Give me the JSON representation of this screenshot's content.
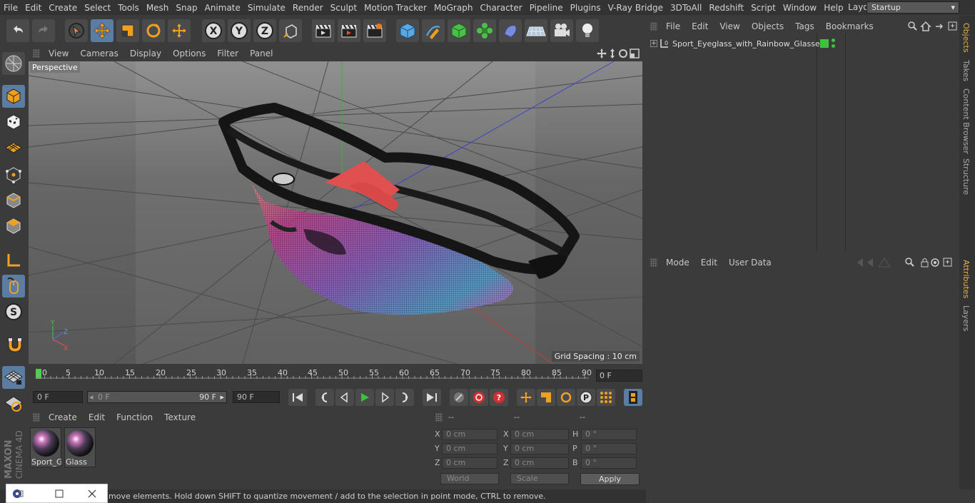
{
  "menubar": {
    "items": [
      "File",
      "Edit",
      "Create",
      "Select",
      "Tools",
      "Mesh",
      "Snap",
      "Animate",
      "Simulate",
      "Render",
      "Sculpt",
      "Motion Tracker",
      "MoGraph",
      "Character",
      "Pipeline",
      "Plugins",
      "V-Ray Bridge",
      "3DToAll",
      "Redshift",
      "Script",
      "Window",
      "Help"
    ],
    "layout_label": "Layout:",
    "layout_value": "Startup"
  },
  "viewport": {
    "menu": [
      "View",
      "Cameras",
      "Display",
      "Options",
      "Filter",
      "Panel"
    ],
    "label": "Perspective",
    "grid_spacing": "Grid Spacing : 10 cm"
  },
  "timeline": {
    "ticks": [
      "0",
      "5",
      "10",
      "15",
      "20",
      "25",
      "30",
      "35",
      "40",
      "45",
      "50",
      "55",
      "60",
      "65",
      "70",
      "75",
      "80",
      "85",
      "90"
    ],
    "current_frame": "0 F",
    "start_field": "0 F",
    "range_start": "0 F",
    "range_end": "90 F",
    "end_field": "90 F"
  },
  "materials": {
    "menu": [
      "Create",
      "Edit",
      "Function",
      "Texture"
    ],
    "items": [
      "Sport_G",
      "Glass"
    ]
  },
  "coords": {
    "headers": [
      "--",
      "--",
      "--"
    ],
    "rows": [
      {
        "a": "X",
        "av": "0 cm",
        "b": "X",
        "bv": "0 cm",
        "c": "H",
        "cv": "0 °"
      },
      {
        "a": "Y",
        "av": "0 cm",
        "b": "Y",
        "bv": "0 cm",
        "c": "P",
        "cv": "0 °"
      },
      {
        "a": "Z",
        "av": "0 cm",
        "b": "Z",
        "bv": "0 cm",
        "c": "B",
        "cv": "0 °"
      }
    ],
    "world": "World",
    "scale": "Scale",
    "apply": "Apply"
  },
  "objects": {
    "menu": [
      "File",
      "Edit",
      "View",
      "Objects",
      "Tags",
      "Bookmarks"
    ],
    "tree": [
      {
        "name": "Sport_Eyeglass_with_Rainbow_Glasses"
      }
    ]
  },
  "attributes": {
    "menu": [
      "Mode",
      "Edit",
      "User Data"
    ]
  },
  "sidetabs": {
    "top": [
      "Objects",
      "Takes",
      "Content Browser",
      "Structure"
    ],
    "bottom": [
      "Attributes",
      "Layers"
    ]
  },
  "status": {
    "text": "move elements. Hold down SHIFT to quantize movement / add to the selection in point mode, CTRL to remove."
  },
  "brand": {
    "maxon": "MAXON",
    "c4d": "CINEMA 4D"
  },
  "colors": {
    "accent": "#5c7da3",
    "active_tab": "#e0b04a",
    "green_tag": "#3ec23e"
  }
}
